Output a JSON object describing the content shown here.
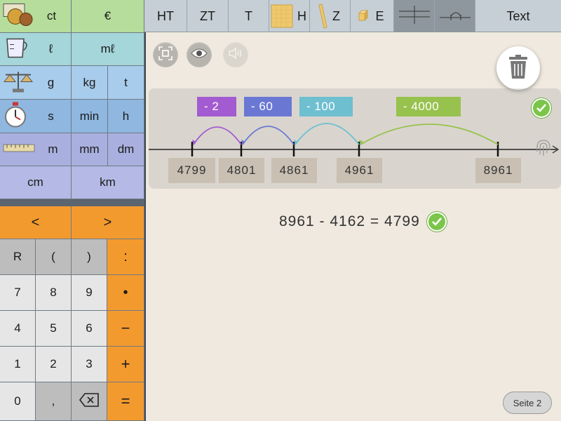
{
  "units": {
    "money": [
      "ct",
      "€"
    ],
    "volume": [
      "ℓ",
      "mℓ"
    ],
    "mass": [
      "g",
      "kg",
      "t"
    ],
    "time": [
      "s",
      "min",
      "h"
    ],
    "length_small": [
      "m",
      "mm",
      "dm"
    ],
    "length_large": [
      "cm",
      "km"
    ]
  },
  "keypad": {
    "compare": [
      "<",
      ">"
    ],
    "row1": [
      "R",
      "(",
      ")",
      ":"
    ],
    "row2": [
      "7",
      "8",
      "9",
      "•"
    ],
    "row3": [
      "4",
      "5",
      "6",
      "−"
    ],
    "row4": [
      "1",
      "2",
      "3",
      "+"
    ],
    "row5": [
      "0",
      ",",
      "⌫",
      "="
    ]
  },
  "toolbar": {
    "places": [
      "HT",
      "ZT",
      "T",
      "H",
      "Z",
      "E"
    ],
    "text_label": "Text"
  },
  "colors": {
    "jump_purple": "#a25bd0",
    "jump_blue": "#6a78d4",
    "jump_teal": "#6ebfd0",
    "jump_green": "#97c24e",
    "check_green": "#7bc54a"
  },
  "number_line": {
    "ticks": [
      "4799",
      "4801",
      "4861",
      "4961",
      "8961"
    ],
    "jumps": [
      "- 2",
      "- 60",
      "- 100",
      "- 4000"
    ]
  },
  "equation": {
    "text": "8961 - 4162 = 4799"
  },
  "page_button": "Seite 2"
}
